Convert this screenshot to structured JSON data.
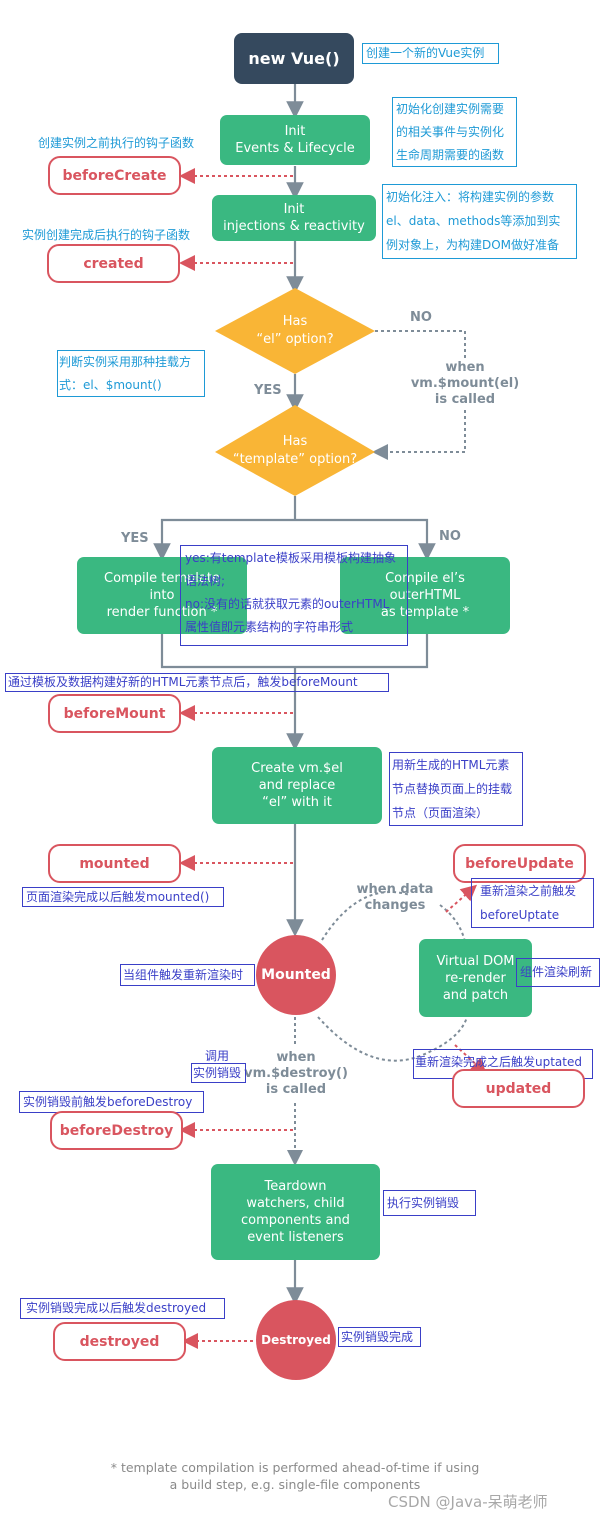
{
  "colors": {
    "dark_node": "#35495e",
    "green_node": "#3ab881",
    "hook_red": "#d9555f",
    "diamond_yellow": "#f9b536",
    "connector_gray": "#7e8c98",
    "note_cyan": "#1e9ad6",
    "note_blue": "#3a3fc7"
  },
  "nodes": {
    "new_vue": "new Vue()",
    "init_events": [
      "Init",
      "Events & Lifecycle"
    ],
    "init_injections": [
      "Init",
      "injections & reactivity"
    ],
    "has_el": [
      "Has",
      "“el” option?"
    ],
    "has_template": [
      "Has",
      "“template” option?"
    ],
    "compile_template": [
      "Compile template",
      "into",
      "render function *"
    ],
    "compile_el": [
      "Compile el’s",
      "outerHTML",
      "as template *"
    ],
    "create_vm_el": [
      "Create vm.$el",
      "and replace",
      "“el” with it"
    ],
    "mounted_state": "Mounted",
    "virtual_dom": [
      "Virtual DOM",
      "re-render",
      "and patch"
    ],
    "teardown": [
      "Teardown",
      "watchers, child",
      "components and",
      "event listeners"
    ],
    "destroyed_state": "Destroyed"
  },
  "hooks": {
    "before_create": "beforeCreate",
    "created": "created",
    "before_mount": "beforeMount",
    "mounted": "mounted",
    "before_update": "beforeUpdate",
    "updated": "updated",
    "before_destroy": "beforeDestroy",
    "destroyed": "destroyed"
  },
  "labels": {
    "no_el": "NO",
    "yes_el": "YES",
    "when_mount": [
      "when",
      "vm.$mount(el)",
      "is called"
    ],
    "yes_template": "YES",
    "no_template": "NO",
    "when_data_changes": [
      "when data",
      "changes"
    ],
    "when_destroy": [
      "when",
      "vm.$destroy()",
      "is called"
    ]
  },
  "annotations": {
    "new_vue_note": "创建一个新的Vue实例",
    "init_events_note": [
      "初始化创建实例需要",
      "的相关事件与实例化",
      "生命周期需要的函数"
    ],
    "before_create_note": "创建实例之前执行的钩子函数",
    "init_injections_note": [
      "初始化注入：将构建实例的参数",
      "el、data、methods等添加到实",
      "例对象上，为构建DOM做好准备"
    ],
    "created_note": "实例创建完成后执行的钩子函数",
    "mount_method_note": [
      "判断实例采用那种挂载方",
      "式：el、$mount()"
    ],
    "template_note": [
      "yes:有template模板采用模板构建抽象",
      "语法树;",
      "no:没有的话就获取元素的outerHTML",
      "属性值即元素结构的字符串形式"
    ],
    "before_mount_note": "通过模板及数据构建好新的HTML元素节点后，触发beforeMount",
    "create_vm_el_note": [
      "用新生成的HTML元素",
      "节点替换页面上的挂载",
      "节点（页面渲染）"
    ],
    "mounted_note": "页面渲染完成以后触发mounted()",
    "rerender_note": "当组件触发重新渲染时",
    "before_update_note": [
      "重新渲染之前触发",
      "beforeUptate"
    ],
    "virtual_dom_note": "组件渲染刷新",
    "updated_note": "重新渲染完成之后触发uptated",
    "call_label": "调用",
    "destroy_call_note": "实例销毁",
    "before_destroy_note": "实例销毁前触发beforeDestroy",
    "teardown_note": "执行实例销毁",
    "destroyed_note": "实例销毁完成以后触发destroyed",
    "destroyed_state_note": "实例销毁完成"
  },
  "footer": [
    "* template compilation is performed ahead-of-time if using",
    "a build step, e.g. single-file components"
  ],
  "watermark": "CSDN @Java-呆萌老师"
}
